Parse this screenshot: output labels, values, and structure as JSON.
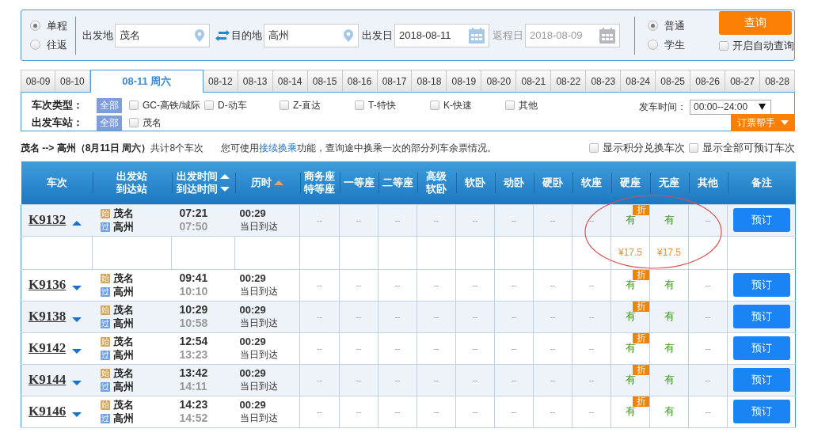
{
  "trip_type": [
    {
      "label": "单程",
      "selected": true
    },
    {
      "label": "往返",
      "selected": false
    }
  ],
  "from": {
    "label": "出发地",
    "value": "茂名"
  },
  "to": {
    "label": "目的地",
    "value": "高州"
  },
  "depart_date": {
    "label": "出发日",
    "value": "2018-08-11",
    "disabled": false
  },
  "return_date": {
    "label": "返程日",
    "value": "2018-08-09",
    "disabled": true
  },
  "ticket_type": [
    {
      "label": "普通",
      "selected": true
    },
    {
      "label": "学生",
      "selected": false
    }
  ],
  "query_button": "查询",
  "auto_query": {
    "label": "开启自动查询",
    "checked": false
  },
  "date_tabs": [
    {
      "label": "08-09",
      "selected": false
    },
    {
      "label": "08-10",
      "selected": false
    },
    {
      "label": "08-11 周六",
      "selected": true
    },
    {
      "label": "08-12",
      "selected": false
    },
    {
      "label": "08-13",
      "selected": false
    },
    {
      "label": "08-14",
      "selected": false
    },
    {
      "label": "08-15",
      "selected": false
    },
    {
      "label": "08-16",
      "selected": false
    },
    {
      "label": "08-17",
      "selected": false
    },
    {
      "label": "08-18",
      "selected": false
    },
    {
      "label": "08-19",
      "selected": false
    },
    {
      "label": "08-20",
      "selected": false
    },
    {
      "label": "08-21",
      "selected": false
    },
    {
      "label": "08-22",
      "selected": false
    },
    {
      "label": "08-23",
      "selected": false
    },
    {
      "label": "08-24",
      "selected": false
    },
    {
      "label": "08-25",
      "selected": false
    },
    {
      "label": "08-26",
      "selected": false
    },
    {
      "label": "08-27",
      "selected": false
    },
    {
      "label": "08-28",
      "selected": false
    }
  ],
  "filters": {
    "train_type": {
      "label": "车次类型：",
      "all": "全部",
      "options": [
        {
          "label": "GC-高铁/城际",
          "checked": false
        },
        {
          "label": "D-动车",
          "checked": false
        },
        {
          "label": "Z-直达",
          "checked": false
        },
        {
          "label": "T-特快",
          "checked": false
        },
        {
          "label": "K-快速",
          "checked": false
        },
        {
          "label": "其他",
          "checked": false
        }
      ]
    },
    "station": {
      "label": "出发车站：",
      "all": "全部",
      "options": [
        {
          "label": "茂名",
          "checked": false
        }
      ]
    },
    "depart_time": {
      "label": "发车时间：",
      "value": "00:00--24:00"
    },
    "helper_button": "订票帮手"
  },
  "summary": {
    "route": "茂名 --> 高州（8月11日  周六）",
    "count": "共计8个车次",
    "notice_before": "您可使用",
    "notice_link": "接续换乘",
    "notice_after": "功能，查询途中换乘一次的部分列车余票情况。",
    "options": [
      {
        "label": "显示积分兑换车次",
        "checked": false
      },
      {
        "label": "显示全部可预订车次",
        "checked": false
      }
    ]
  },
  "table": {
    "columns": [
      {
        "lines": [
          {
            "text": "车次"
          }
        ]
      },
      {
        "lines": [
          {
            "text": "出发站"
          },
          {
            "text": "到达站"
          }
        ]
      },
      {
        "lines": [
          {
            "text": "出发时间",
            "kind": "up"
          },
          {
            "text": "到达时间",
            "kind": "down"
          }
        ]
      },
      {
        "lines": [
          {
            "text": "历时",
            "kind": "up-active"
          }
        ]
      },
      {
        "lines": [
          {
            "text": "商务座"
          },
          {
            "text": "特等座"
          }
        ]
      },
      {
        "lines": [
          {
            "text": "一等座"
          }
        ]
      },
      {
        "lines": [
          {
            "text": "二等座"
          }
        ]
      },
      {
        "lines": [
          {
            "text": "高级"
          },
          {
            "text": "软卧"
          }
        ]
      },
      {
        "lines": [
          {
            "text": "软卧"
          }
        ]
      },
      {
        "lines": [
          {
            "text": "动卧"
          }
        ]
      },
      {
        "lines": [
          {
            "text": "硬卧"
          }
        ]
      },
      {
        "lines": [
          {
            "text": "软座"
          }
        ]
      },
      {
        "lines": [
          {
            "text": "硬座"
          }
        ]
      },
      {
        "lines": [
          {
            "text": "无座"
          }
        ]
      },
      {
        "lines": [
          {
            "text": "其他"
          }
        ]
      },
      {
        "lines": [
          {
            "text": "备注"
          }
        ]
      }
    ],
    "rows": [
      {
        "train": "K9132",
        "expanded": true,
        "from": {
          "tag": "始",
          "kind": "start",
          "name": "茂名"
        },
        "to": {
          "tag": "过",
          "kind": "pass",
          "name": "高州"
        },
        "depart": "07:21",
        "arrive": "07:50",
        "duration": "00:29",
        "arrival_day": "当日到达",
        "seats": [
          {
            "kind": "none",
            "text": "--"
          },
          {
            "kind": "none",
            "text": "--"
          },
          {
            "kind": "none",
            "text": "--"
          },
          {
            "kind": "none",
            "text": "--"
          },
          {
            "kind": "none",
            "text": "--"
          },
          {
            "kind": "none",
            "text": "--"
          },
          {
            "kind": "none",
            "text": "--"
          },
          {
            "kind": "none",
            "text": "--"
          },
          {
            "kind": "available",
            "text": "有",
            "badge": "折",
            "price": "¥17.5"
          },
          {
            "kind": "available",
            "text": "有",
            "price": "¥17.5"
          },
          {
            "kind": "none",
            "text": "--"
          }
        ],
        "button": "预订"
      },
      {
        "train": "K9136",
        "expanded": false,
        "from": {
          "tag": "始",
          "kind": "start",
          "name": "茂名"
        },
        "to": {
          "tag": "过",
          "kind": "pass",
          "name": "高州"
        },
        "depart": "09:41",
        "arrive": "10:10",
        "duration": "00:29",
        "arrival_day": "当日到达",
        "seats": [
          {
            "kind": "none",
            "text": "--"
          },
          {
            "kind": "none",
            "text": "--"
          },
          {
            "kind": "none",
            "text": "--"
          },
          {
            "kind": "none",
            "text": "--"
          },
          {
            "kind": "none",
            "text": "--"
          },
          {
            "kind": "none",
            "text": "--"
          },
          {
            "kind": "none",
            "text": "--"
          },
          {
            "kind": "none",
            "text": "--"
          },
          {
            "kind": "available",
            "text": "有",
            "badge": "折"
          },
          {
            "kind": "available",
            "text": "有"
          },
          {
            "kind": "none",
            "text": "--"
          }
        ],
        "button": "预订"
      },
      {
        "train": "K9138",
        "expanded": false,
        "from": {
          "tag": "始",
          "kind": "start",
          "name": "茂名"
        },
        "to": {
          "tag": "过",
          "kind": "pass",
          "name": "高州"
        },
        "depart": "10:29",
        "arrive": "10:58",
        "duration": "00:29",
        "arrival_day": "当日到达",
        "seats": [
          {
            "kind": "none",
            "text": "--"
          },
          {
            "kind": "none",
            "text": "--"
          },
          {
            "kind": "none",
            "text": "--"
          },
          {
            "kind": "none",
            "text": "--"
          },
          {
            "kind": "none",
            "text": "--"
          },
          {
            "kind": "none",
            "text": "--"
          },
          {
            "kind": "none",
            "text": "--"
          },
          {
            "kind": "none",
            "text": "--"
          },
          {
            "kind": "available",
            "text": "有",
            "badge": "折"
          },
          {
            "kind": "available",
            "text": "有"
          },
          {
            "kind": "none",
            "text": "--"
          }
        ],
        "button": "预订"
      },
      {
        "train": "K9142",
        "expanded": false,
        "from": {
          "tag": "始",
          "kind": "start",
          "name": "茂名"
        },
        "to": {
          "tag": "过",
          "kind": "pass",
          "name": "高州"
        },
        "depart": "12:54",
        "arrive": "13:23",
        "duration": "00:29",
        "arrival_day": "当日到达",
        "seats": [
          {
            "kind": "none",
            "text": "--"
          },
          {
            "kind": "none",
            "text": "--"
          },
          {
            "kind": "none",
            "text": "--"
          },
          {
            "kind": "none",
            "text": "--"
          },
          {
            "kind": "none",
            "text": "--"
          },
          {
            "kind": "none",
            "text": "--"
          },
          {
            "kind": "none",
            "text": "--"
          },
          {
            "kind": "none",
            "text": "--"
          },
          {
            "kind": "available",
            "text": "有",
            "badge": "折"
          },
          {
            "kind": "available",
            "text": "有"
          },
          {
            "kind": "none",
            "text": "--"
          }
        ],
        "button": "预订"
      },
      {
        "train": "K9144",
        "expanded": false,
        "from": {
          "tag": "始",
          "kind": "start",
          "name": "茂名"
        },
        "to": {
          "tag": "过",
          "kind": "pass",
          "name": "高州"
        },
        "depart": "13:42",
        "arrive": "14:11",
        "duration": "00:29",
        "arrival_day": "当日到达",
        "seats": [
          {
            "kind": "none",
            "text": "--"
          },
          {
            "kind": "none",
            "text": "--"
          },
          {
            "kind": "none",
            "text": "--"
          },
          {
            "kind": "none",
            "text": "--"
          },
          {
            "kind": "none",
            "text": "--"
          },
          {
            "kind": "none",
            "text": "--"
          },
          {
            "kind": "none",
            "text": "--"
          },
          {
            "kind": "none",
            "text": "--"
          },
          {
            "kind": "available",
            "text": "有",
            "badge": "折"
          },
          {
            "kind": "available",
            "text": "有"
          },
          {
            "kind": "none",
            "text": "--"
          }
        ],
        "button": "预订"
      },
      {
        "train": "K9146",
        "expanded": false,
        "from": {
          "tag": "始",
          "kind": "start",
          "name": "茂名"
        },
        "to": {
          "tag": "过",
          "kind": "pass",
          "name": "高州"
        },
        "depart": "14:23",
        "arrive": "14:52",
        "duration": "00:29",
        "arrival_day": "当日到达",
        "seats": [
          {
            "kind": "none",
            "text": "--"
          },
          {
            "kind": "none",
            "text": "--"
          },
          {
            "kind": "none",
            "text": "--"
          },
          {
            "kind": "none",
            "text": "--"
          },
          {
            "kind": "none",
            "text": "--"
          },
          {
            "kind": "none",
            "text": "--"
          },
          {
            "kind": "none",
            "text": "--"
          },
          {
            "kind": "none",
            "text": "--"
          },
          {
            "kind": "available",
            "text": "有",
            "badge": "折"
          },
          {
            "kind": "available",
            "text": "有"
          },
          {
            "kind": "none",
            "text": "--"
          }
        ],
        "button": "预订"
      }
    ]
  }
}
